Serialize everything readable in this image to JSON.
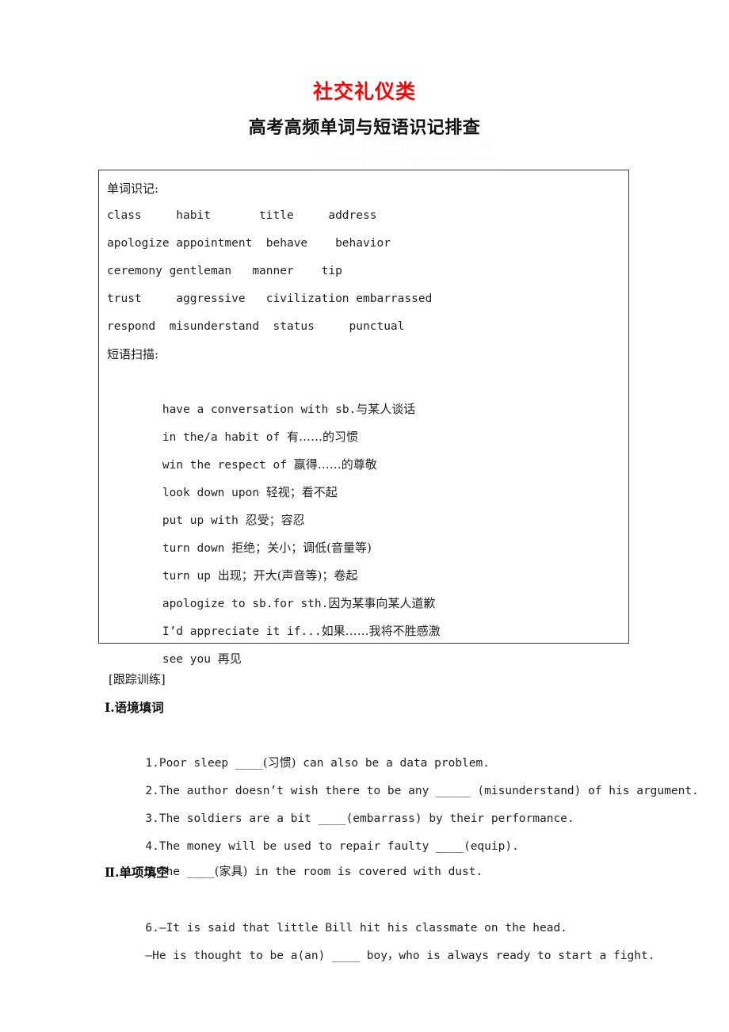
{
  "document": {
    "title": "社交礼仪类",
    "subtitle": "高考高频单词与短语识记排查",
    "title_color": "#ff0000",
    "subtitle_color": "#111111"
  },
  "box": {
    "words_heading": "单词识记:",
    "word_rows": [
      "class     habit       title     address",
      "apologize appointment  behave    behavior",
      "ceremony gentleman   manner    tip",
      "trust     aggressive   civilization embarrassed",
      "respond  misunderstand  status     punctual"
    ],
    "words_flat": [
      "class",
      "habit",
      "title",
      "address",
      "apologize",
      "appointment",
      "behave",
      "behavior",
      "ceremony",
      "gentleman",
      "manner",
      "tip",
      "trust",
      "aggressive",
      "civilization",
      "embarrassed",
      "respond",
      "misunderstand",
      "status",
      "punctual"
    ],
    "phrases_heading": "短语扫描:",
    "phrase_rows": [
      {
        "en": "have a conversation with sb.",
        "cn": "与某人谈话"
      },
      {
        "en": "in the/a habit of ",
        "cn": "有……的习惯"
      },
      {
        "en": "win the respect of ",
        "cn": "赢得……的尊敬"
      },
      {
        "en": "look down upon ",
        "cn": "轻视；看不起"
      },
      {
        "en": "put up with ",
        "cn": "忍受；容忍"
      },
      {
        "en": "turn down ",
        "cn": "拒绝；关小；调低(音量等)"
      },
      {
        "en": "turn up ",
        "cn": "出现；开大(声音等)；卷起"
      },
      {
        "en": "apologize to sb.for sth.",
        "cn": "因为某事向某人道歉"
      },
      {
        "en": "I’d appreciate it if...",
        "cn": "如果……我将不胜感激"
      },
      {
        "en": "see you ",
        "cn": "再见"
      }
    ]
  },
  "exercises": {
    "tag": "[跟踪训练]",
    "section_one": "Ⅰ.语境填词",
    "items_one": [
      {
        "pre": "1.Poor sleep ",
        "blank": "____",
        "cn": "(习惯)",
        "post": " can also be a data problem."
      },
      {
        "pre": "2.The author doesn’t wish there to be any ",
        "blank": "_____",
        "cn": "",
        "post": " (misunderstand) of his argument."
      },
      {
        "pre": "3.The soldiers are a bit ",
        "blank": "____",
        "cn": "",
        "post": "(embarrass) by their performance."
      },
      {
        "pre": "4.The money will be used to repair faulty ",
        "blank": "____",
        "cn": "",
        "post": "(equip)."
      },
      {
        "pre": "5.The ",
        "blank": "____",
        "cn": "(家具)",
        "post": " in the room is covered with dust."
      }
    ],
    "section_two": "Ⅱ.单项填空",
    "items_two": [
      {
        "pre": "6.—It is said that little Bill hit his classmate on the head.",
        "blank": "",
        "cn": "",
        "post": ""
      },
      {
        "pre": "—He is thought to be a(an) ",
        "blank": "____",
        "cn": "",
        "post": " boy，who is always ready to start a fight."
      }
    ]
  }
}
